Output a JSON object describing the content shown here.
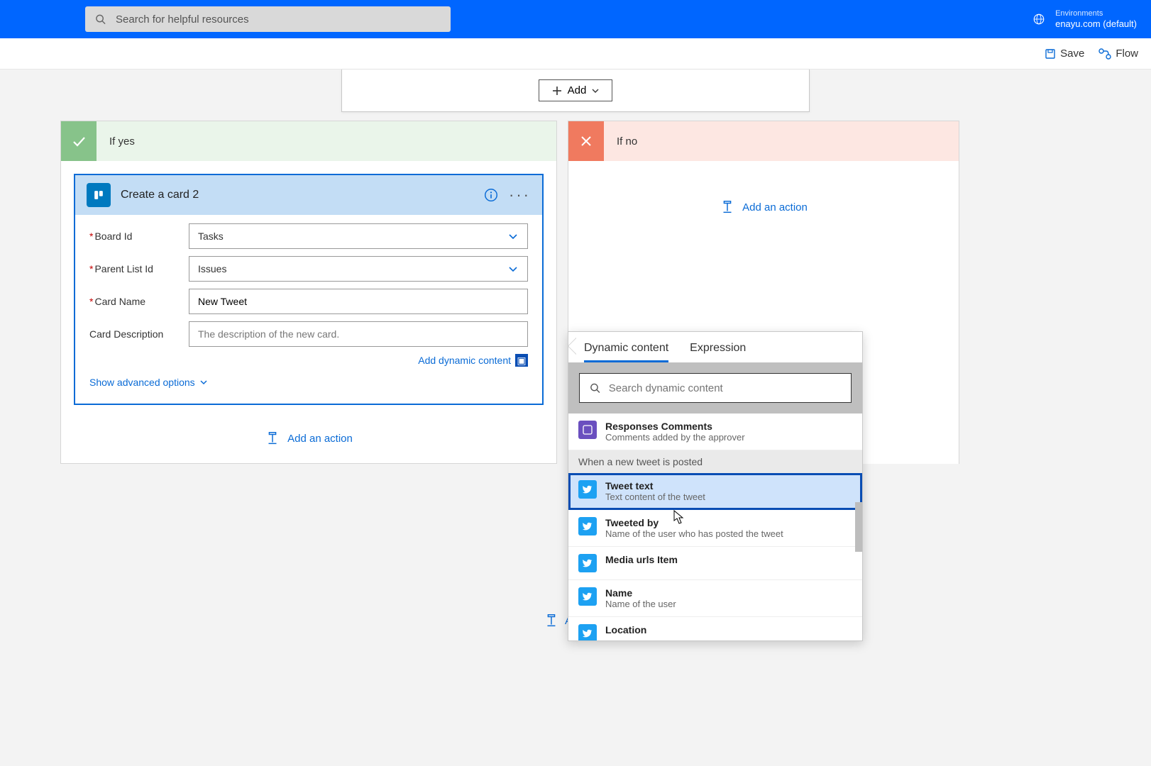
{
  "header": {
    "searchPlaceholder": "Search for helpful resources",
    "envLabel": "Environments",
    "envName": "enayu.com (default)"
  },
  "toolbar": {
    "save": "Save",
    "flow": "Flow"
  },
  "addButton": "Add",
  "branches": {
    "yes": {
      "title": "If yes"
    },
    "no": {
      "title": "If no",
      "addAction": "Add an action"
    }
  },
  "card": {
    "title": "Create a card 2",
    "fields": {
      "boardId": {
        "label": "Board Id",
        "value": "Tasks"
      },
      "parentList": {
        "label": "Parent List Id",
        "value": "Issues"
      },
      "cardName": {
        "label": "Card Name",
        "value": "New Tweet"
      },
      "cardDesc": {
        "label": "Card Description",
        "placeholder": "The description of the new card."
      }
    },
    "dynamicLink": "Add dynamic content",
    "advanced": "Show advanced options",
    "addAction": "Add an action"
  },
  "bottomAdd": "Add an a",
  "popup": {
    "tabs": {
      "dynamic": "Dynamic content",
      "expression": "Expression"
    },
    "searchPlaceholder": "Search dynamic content",
    "topItem": {
      "title": "Responses Comments",
      "desc": "Comments added by the approver"
    },
    "groupHead": "When a new tweet is posted",
    "items": [
      {
        "title": "Tweet text",
        "desc": "Text content of the tweet",
        "selected": true
      },
      {
        "title": "Tweeted by",
        "desc": "Name of the user who has posted the tweet"
      },
      {
        "title": "Media urls Item",
        "desc": ""
      },
      {
        "title": "Name",
        "desc": "Name of the user"
      },
      {
        "title": "Location",
        "desc": ""
      }
    ]
  }
}
